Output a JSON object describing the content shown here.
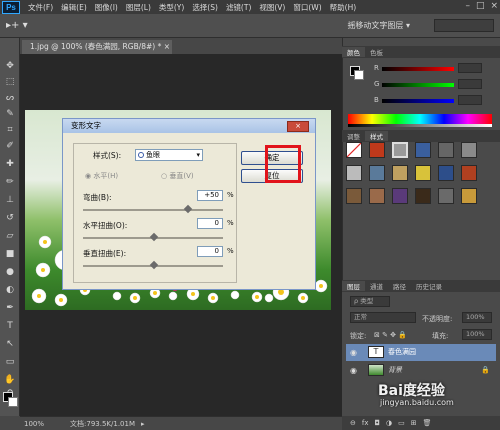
{
  "app": {
    "logo": "Ps"
  },
  "menu": [
    "文件(F)",
    "编辑(E)",
    "图像(I)",
    "图层(L)",
    "类型(Y)",
    "选择(S)",
    "滤镜(T)",
    "视图(V)",
    "窗口(W)",
    "帮助(H)"
  ],
  "options_bar": {
    "tool_glyph": "▸+ ▾",
    "right_text": "摇移动文字图层 ▾"
  },
  "document": {
    "tab_title": "1.jpg @ 100% (春色满园, RGB/8#) * ×"
  },
  "status_bar": {
    "zoom": "100%",
    "doc_info": "文档:793.5K/1.01M"
  },
  "dialog": {
    "title": "变形文字",
    "close_label": "×",
    "style_label": "样式(S):",
    "style_value": "鱼眼",
    "horizontal_label": "水平(H)",
    "vertical_label": "垂直(V)",
    "bend_label": "弯曲(B):",
    "bend_value": "+50",
    "bend_level_percent": 50,
    "hdistort_label": "水平扭曲(O):",
    "hdistort_value": "0",
    "vdistort_label": "垂直扭曲(E):",
    "vdistort_value": "0",
    "pct": "%",
    "ok_label": "确定",
    "reset_label": "复位"
  },
  "color_panel": {
    "tabs": [
      "颜色",
      "色板"
    ],
    "channels": [
      {
        "label": "R",
        "value": ""
      },
      {
        "label": "G",
        "value": ""
      },
      {
        "label": "B",
        "value": ""
      }
    ]
  },
  "styles_panel": {
    "tabs": [
      "调整",
      "样式"
    ]
  },
  "layers_panel": {
    "tabs": [
      "图层",
      "通道",
      "路径",
      "历史记录"
    ],
    "filter_label": "ρ 类型",
    "blend_mode": "正常",
    "opacity_label": "不透明度:",
    "opacity_value": "100%",
    "lock_label": "锁定:",
    "fill_label": "填充:",
    "fill_value": "100%",
    "layers": [
      {
        "name": "春色满园",
        "type": "text",
        "selected": true
      },
      {
        "name": "背景",
        "type": "image",
        "selected": false,
        "locked": true
      }
    ],
    "footer_icons": [
      "link-icon",
      "fx-icon",
      "mask-icon",
      "adjust-icon",
      "folder-icon",
      "new-layer-icon",
      "trash-icon"
    ]
  },
  "watermark": {
    "brand": "Bai度经验",
    "url": "jingyan.baidu.com"
  }
}
